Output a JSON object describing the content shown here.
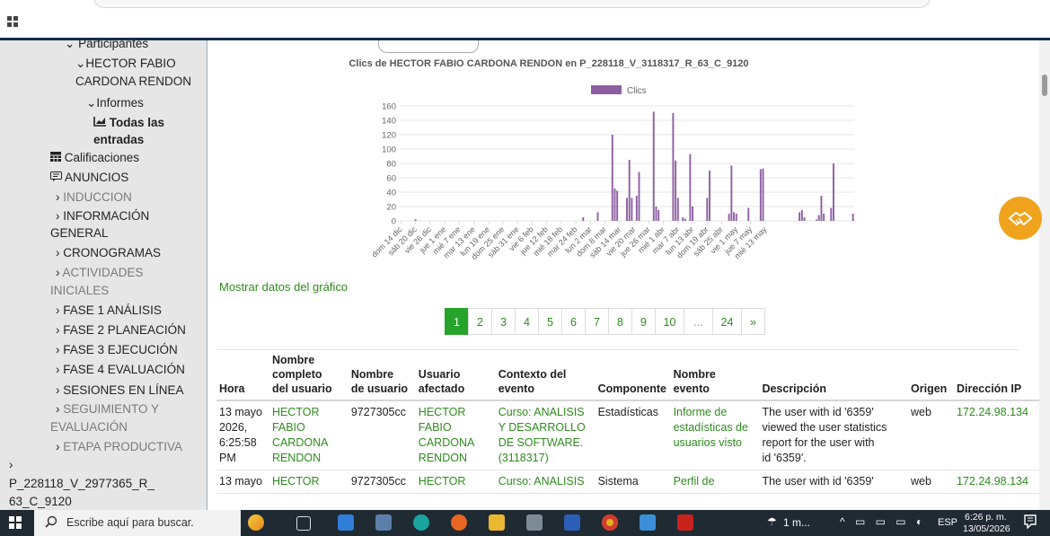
{
  "browser": {
    "apps_icon": "apps-grid-icon"
  },
  "sidebar": {
    "participantes": "Participantes",
    "user": [
      "HECTOR FABIO",
      "CARDONA RENDON"
    ],
    "informes": "Informes",
    "todas": [
      "Todas las",
      "entradas"
    ],
    "calificaciones": "Calificaciones",
    "anuncios": "ANUNCIOS",
    "sections": [
      {
        "label": "INDUCCION"
      },
      {
        "label": "INFORMACIÓN",
        "label2": "GENERAL"
      },
      {
        "label": "CRONOGRAMAS"
      },
      {
        "label": "ACTIVIDADES",
        "label2": "INICIALES"
      },
      {
        "label": "FASE 1 ANÁLISIS"
      },
      {
        "label": "FASE 2 PLANEACIÓN"
      },
      {
        "label": "FASE 3 EJECUCIÓN"
      },
      {
        "label": "FASE 4 EVALUACIÓN"
      },
      {
        "label": "SESIONES EN LÍNEA"
      },
      {
        "label": "SEGUIMIENTO Y",
        "label2": "EVALUACIÓN"
      },
      {
        "label": "ETAPA PRODUCTIVA"
      }
    ],
    "course": [
      "P_228118_V_2977365_R_",
      "63_C_9120"
    ]
  },
  "chart_data": {
    "type": "bar",
    "title": "Clics de HECTOR FABIO CARDONA RENDON en P_228118_V_3118317_R_63_C_9120",
    "legend": "Clics",
    "color": "#8e5ea2",
    "ylim": [
      0,
      160
    ],
    "yticks": [
      0,
      20,
      40,
      60,
      80,
      100,
      120,
      140,
      160
    ],
    "x_tick_labels": [
      "dom 14 dic",
      "sáb 20 dic",
      "vie 26 dic",
      "jue 1 ene",
      "mié 7 ene",
      "mar 13 ene",
      "lun 19 ene",
      "dom 25 ene",
      "sáb 31 ene",
      "vie 6 feb",
      "jue 12 feb",
      "mié 18 feb",
      "mar 24 feb",
      "lun 2 mar",
      "dom 8 mar",
      "sáb 14 mar",
      "vie 20 mar",
      "jue 26 mar",
      "mié 1 abr",
      "mar 7 abr",
      "lun 13 abr",
      "dom 19 abr",
      "sáb 25 abr",
      "vie 1 may",
      "jue 7 may",
      "mié 13 may"
    ],
    "day_values": [
      0,
      0,
      0,
      0,
      0,
      0,
      2,
      0,
      0,
      0,
      0,
      0,
      0,
      0,
      0,
      0,
      0,
      0,
      0,
      0,
      0,
      0,
      0,
      0,
      0,
      0,
      0,
      0,
      0,
      0,
      0,
      0,
      0,
      0,
      0,
      0,
      0,
      0,
      0,
      0,
      0,
      0,
      0,
      0,
      0,
      0,
      0,
      0,
      0,
      0,
      0,
      0,
      0,
      0,
      0,
      0,
      0,
      0,
      0,
      0,
      0,
      0,
      0,
      0,
      0,
      0,
      0,
      0,
      0,
      0,
      0,
      0,
      0,
      0,
      0,
      5,
      0,
      0,
      0,
      0,
      0,
      12,
      0,
      0,
      0,
      0,
      0,
      120,
      45,
      42,
      0,
      0,
      0,
      32,
      85,
      32,
      0,
      35,
      68,
      0,
      0,
      0,
      0,
      0,
      152,
      20,
      15,
      0,
      0,
      0,
      0,
      0,
      150,
      84,
      32,
      0,
      5,
      3,
      0,
      93,
      20,
      0,
      0,
      0,
      0,
      0,
      32,
      70,
      0,
      0,
      0,
      0,
      0,
      0,
      0,
      10,
      77,
      12,
      10,
      0,
      0,
      0,
      0,
      18,
      0,
      0,
      0,
      0,
      72,
      73,
      0,
      0,
      0,
      0,
      0,
      0,
      0,
      0,
      0,
      0,
      0,
      0,
      0,
      0,
      12,
      15,
      5,
      0,
      0,
      0,
      0,
      2,
      8,
      35,
      10,
      0,
      0,
      18,
      80,
      0,
      0,
      0,
      0,
      0,
      0,
      0,
      10
    ]
  },
  "show_chart_data": "Mostrar datos del gráfico",
  "pagination": [
    "1",
    "2",
    "3",
    "4",
    "5",
    "6",
    "7",
    "8",
    "9",
    "10",
    "...",
    "24",
    "»"
  ],
  "table": {
    "headers": [
      [
        "Hora"
      ],
      [
        "Nombre",
        "completo",
        "del usuario"
      ],
      [
        "Nombre",
        "de usuario"
      ],
      [
        "Usuario",
        "afectado"
      ],
      [
        "Contexto del",
        "evento"
      ],
      [
        "Componente"
      ],
      [
        "Nombre",
        "evento"
      ],
      [
        "Descripción"
      ],
      [
        "Origen"
      ],
      [
        "Dirección IP"
      ]
    ],
    "rows": [
      {
        "hora": [
          "13 mayo",
          "2026,",
          "6:25:58",
          "PM"
        ],
        "nombre": [
          "HECTOR",
          "FABIO",
          "CARDONA",
          "RENDON"
        ],
        "usuario": "9727305cc",
        "afectado": [
          "HECTOR",
          "FABIO",
          "CARDONA",
          "RENDON"
        ],
        "contexto": [
          "Curso: ANALISIS",
          "Y DESARROLLO",
          "DE SOFTWARE.",
          "(3118317)"
        ],
        "componente": "Estadísticas",
        "evento": [
          "Informe de",
          "estadísticas de",
          "usuarios visto"
        ],
        "descripcion": [
          "The user with id '6359'",
          "viewed the user statistics",
          "report for the user with",
          "id '6359'."
        ],
        "origen": "web",
        "ip": "172.24.98.134"
      },
      {
        "hora": [
          "13 mayo"
        ],
        "nombre": [
          "HECTOR"
        ],
        "usuario": "9727305cc",
        "afectado": [
          "HECTOR"
        ],
        "contexto": [
          "Curso: ANALISIS"
        ],
        "componente": "Sistema",
        "evento": [
          "Perfil de"
        ],
        "descripcion": [
          "The user with id '6359'"
        ],
        "origen": "web",
        "ip": "172.24.98.134"
      }
    ]
  },
  "taskbar": {
    "search_placeholder": "Escribe aquí para buscar.",
    "weather": "1 m...",
    "lang": "ESP",
    "time": "6:26 p. m.",
    "date": "13/05/2026"
  }
}
